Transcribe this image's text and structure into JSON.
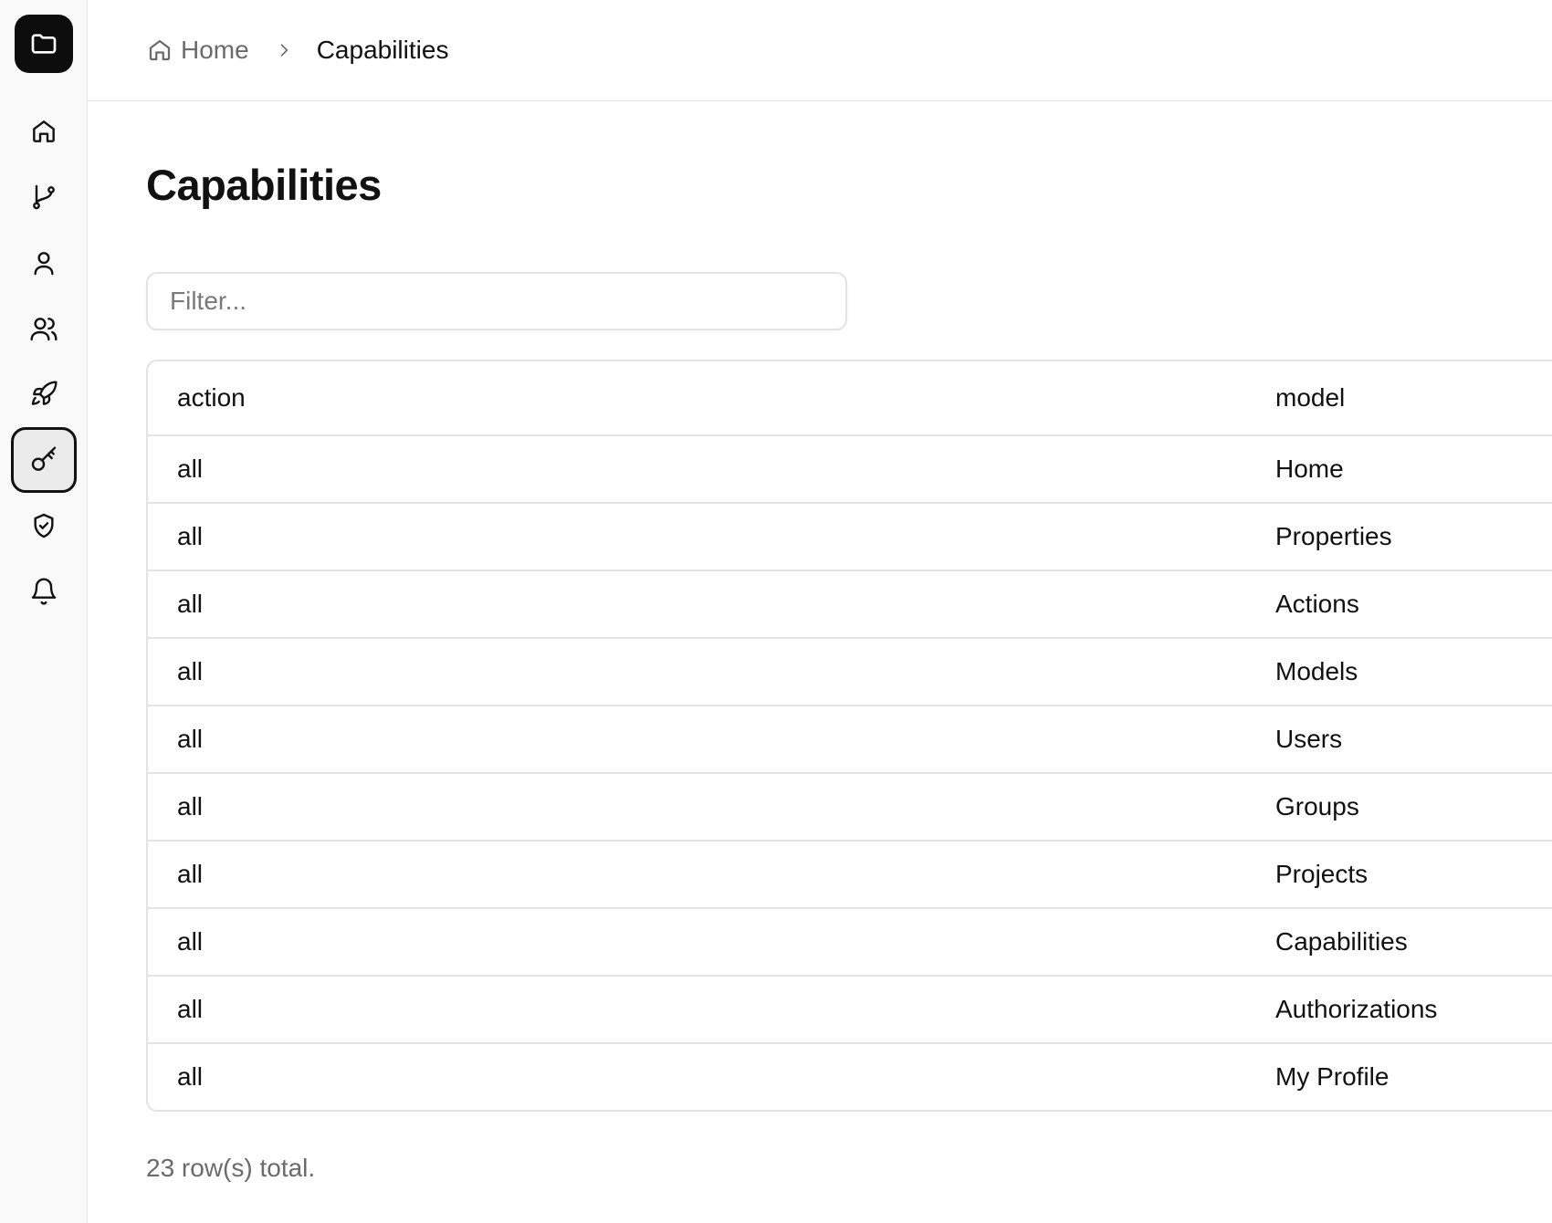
{
  "sidebar": {
    "logo_icon": "folder-icon",
    "items": [
      {
        "name": "home",
        "icon": "home-icon",
        "active": false
      },
      {
        "name": "workflow",
        "icon": "git-branch-icon",
        "active": false
      },
      {
        "name": "user",
        "icon": "user-icon",
        "active": false
      },
      {
        "name": "groups",
        "icon": "users-icon",
        "active": false
      },
      {
        "name": "projects",
        "icon": "rocket-icon",
        "active": false
      },
      {
        "name": "capabilities",
        "icon": "key-icon",
        "active": true
      },
      {
        "name": "authorizations",
        "icon": "shield-check-icon",
        "active": false
      },
      {
        "name": "notifications",
        "icon": "bell-icon",
        "active": false
      }
    ]
  },
  "breadcrumb": {
    "home_label": "Home",
    "current_label": "Capabilities"
  },
  "page": {
    "title": "Capabilities"
  },
  "filter": {
    "placeholder": "Filter...",
    "value": ""
  },
  "table": {
    "columns": [
      "action",
      "model"
    ],
    "rows": [
      {
        "action": "all",
        "model": "Home"
      },
      {
        "action": "all",
        "model": "Properties"
      },
      {
        "action": "all",
        "model": "Actions"
      },
      {
        "action": "all",
        "model": "Models"
      },
      {
        "action": "all",
        "model": "Users"
      },
      {
        "action": "all",
        "model": "Groups"
      },
      {
        "action": "all",
        "model": "Projects"
      },
      {
        "action": "all",
        "model": "Capabilities"
      },
      {
        "action": "all",
        "model": "Authorizations"
      },
      {
        "action": "all",
        "model": "My Profile"
      }
    ]
  },
  "footer": {
    "row_count_text": "23 row(s) total."
  },
  "colors": {
    "sidebar_bg": "#f9f9f9",
    "logo_bg": "#0d0d0d",
    "border": "#e3e3e3",
    "muted_text": "#6b6b6b"
  }
}
